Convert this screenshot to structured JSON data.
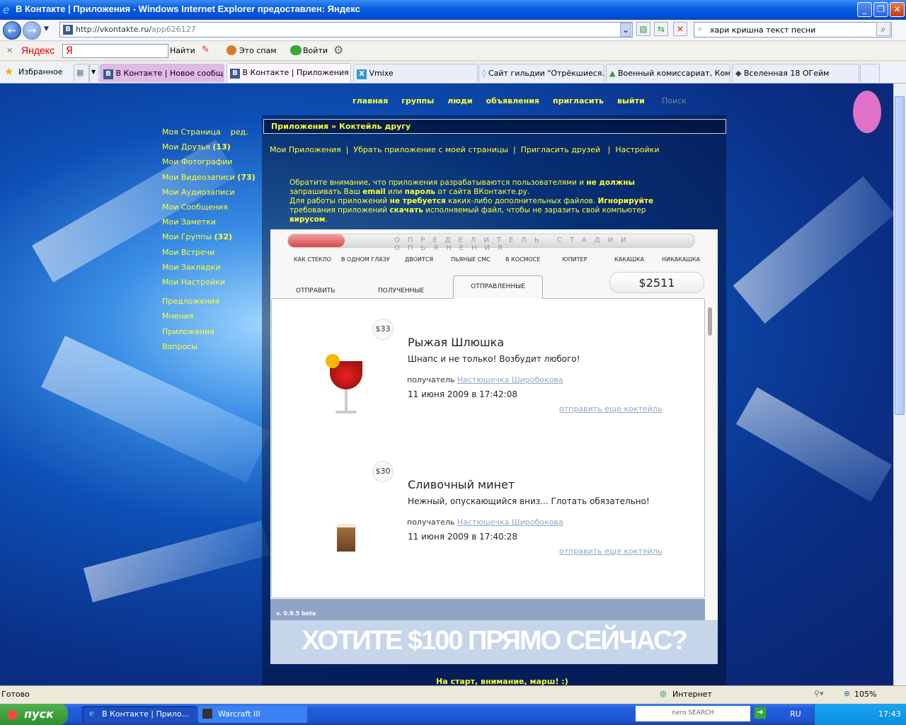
{
  "window": {
    "title": "В Контакте | Приложения - Windows Internet Explorer предоставлен: Яндекс"
  },
  "address": {
    "url_host": "http://vkontakte.ru/",
    "url_path": "app626127",
    "search": "хари кришна текст песни"
  },
  "yandex": {
    "brand": "Яндекс",
    "logo": "Я",
    "find": "Найти",
    "spam": "Это спам",
    "login": "Войти"
  },
  "favorites": "Избранное",
  "tabs": [
    {
      "label": "В Контакте | Новое сообще..."
    },
    {
      "label": "В Контакте | Приложения"
    },
    {
      "label": "Vmixe"
    },
    {
      "label": "Сайт гильдии \"Отрёкшиеся..."
    },
    {
      "label": "Военный комиссариат, Ком..."
    },
    {
      "label": "Вселенная 18 ОГейм"
    }
  ],
  "topnav": [
    "главная",
    "группы",
    "люди",
    "объявления",
    "пригласить",
    "выйти"
  ],
  "search_label": "Поиск",
  "leftmenu": [
    {
      "label": "Моя Страница",
      "extra": "ред."
    },
    {
      "label": "Мои Друзья",
      "count": "(13)"
    },
    {
      "label": "Мои Фотографии"
    },
    {
      "label": "Мои Видеозаписи",
      "count": "(73)"
    },
    {
      "label": "Мои Аудиозаписи"
    },
    {
      "label": "Мои Сообщения"
    },
    {
      "label": "Мои Заметки"
    },
    {
      "label": "Мои Группы",
      "count": "(32)"
    },
    {
      "label": "Мои Встречи"
    },
    {
      "label": "Мои Закладки"
    },
    {
      "label": "Мои Настройки"
    }
  ],
  "leftmenu2": [
    "Предложения",
    "Мнения",
    "Приложения",
    "Вопросы"
  ],
  "breadcrumb": "Приложения » Коктейль другу",
  "applinks": [
    "Мои Приложения",
    "Убрать приложение с моей страницы",
    "Пригласить друзей",
    "Настройки"
  ],
  "warning": {
    "p1a": "Обратите внимание, что приложения разрабатываются пользователями и ",
    "p1b": "не должны",
    "p1c": " запрашивать Ваш ",
    "p1d": "email",
    "p1e": " или ",
    "p1f": "пароль",
    "p1g": " от сайта ВКонтакте.ру.",
    "p2a": "Для работы приложений ",
    "p2b": "не требуется",
    "p2c": " каких-либо дополнительных файлов. ",
    "p2d": "Игнорируйте",
    "p2e": " требования приложений ",
    "p2f": "скачать",
    "p2g": " исполняемый файл, чтобы не заразить свой компьютер ",
    "p2h": "вирусом",
    "p2i": "."
  },
  "app": {
    "meter_title": "ОПРЕДЕЛИТЕЛЬ СТАДИИ ОПЬЯНЕНИЯ",
    "meter_level": 0.14,
    "stages": [
      "КАК СТЕКЛО",
      "В ОДНОМ ГЛАЗУ",
      "ДВОИТСЯ",
      "ПЬЯНЫЕ СМС",
      "В КОСМОСЕ",
      "ЮПИТЕР",
      "КАКАШКА",
      "НИКАКАШКА"
    ],
    "tabs": [
      "ОТПРАВИТЬ",
      "ПОЛУЧЕННЫЕ",
      "ОТПРАВЛЕННЫЕ"
    ],
    "balance": "$2511",
    "items": [
      {
        "price": "$33",
        "name": "Рыжая Шлюшка",
        "desc": "Шнапс и не только! Возбудит любого!",
        "recipient_label": "получатель",
        "recipient": "Настюшечка Широбокова",
        "date": "11 июня 2009 в 17:42:08",
        "more": "отправить еще коктейль"
      },
      {
        "price": "$30",
        "name": "Сливочный минет",
        "desc": "Нежный, опускающийся вниз... Глотать обязательно!",
        "recipient_label": "получатель",
        "recipient": "Настюшечка Широбокова",
        "date": "11 июня 2009 в 17:40:28",
        "more": "отправить еще коктейль"
      }
    ],
    "version": "v. 0.9.5 beta",
    "banner": "ХОТИТЕ $100 ПРЯМО СЕЙЧАС?"
  },
  "footer_text": "На старт, внимание, марш! :)",
  "status": {
    "text": "Готово",
    "zone": "Интернет",
    "zoom": "105%"
  },
  "taskbar": {
    "start": "пуск",
    "tasks": [
      "В Контакте | Прило...",
      "Warcraft III"
    ],
    "nero": "nero SEARCH",
    "lang": "RU",
    "time": "17:43"
  }
}
